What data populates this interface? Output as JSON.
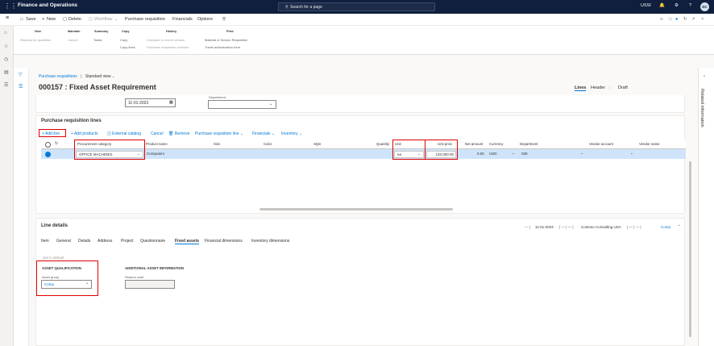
{
  "topbar": {
    "app_title": "Finance and Operations",
    "search_placeholder": "Search for a page",
    "company": "USSI",
    "avatar_initials": "DC"
  },
  "actions": {
    "save": "Save",
    "new": "New",
    "delete": "Delete",
    "workflow": "Workflow",
    "tab_purchase_requisition": "Purchase requisition",
    "tab_financials": "Financials",
    "tab_options": "Options"
  },
  "ribbon": {
    "groups": {
      "new": "New",
      "maintain": "Maintain",
      "summary": "Summary",
      "copy": "Copy",
      "history": "History",
      "print": "Print"
    },
    "items": {
      "request_for_quotation": "Request for quotation",
      "cancel": "Cancel",
      "totals": "Totals",
      "copy": "Copy",
      "copy_lines": "Copy lines",
      "compare_to_recent": "Compare to recent version",
      "purchase_requisition_versions": "Purchase requisition versions",
      "material_service_requisition": "Material & Service Requisition",
      "travel_authorization_form": "Travel authorization form"
    }
  },
  "breadcrumb": {
    "link": "Purchase requisitions",
    "separator": "|",
    "view": "Standard view"
  },
  "page": {
    "title": "000157 : Fixed Asset Requirement",
    "tab_lines": "Lines",
    "tab_header": "Header",
    "status": "Draft"
  },
  "header_fields": {
    "date_value": "11-01-2023",
    "department_label": "Department"
  },
  "lines": {
    "section_title": "Purchase requisition lines",
    "toolbar": {
      "add_line": "+ Add line",
      "add_products": "Add products",
      "external_catalog": "External catalog",
      "cancel": "Cancel",
      "remove": "Remove",
      "pr_line": "Purchase requisition line",
      "financials": "Financials",
      "inventory": "Inventory"
    },
    "columns": {
      "procurement_category": "Procurement category",
      "product_name": "Product name",
      "size": "Size",
      "color": "Color",
      "style": "Style",
      "quantity": "Quantity",
      "unit": "Unit",
      "unit_price": "Unit price",
      "net_amount": "Net amount",
      "currency": "Currency",
      "department": "Department",
      "vendor_account": "Vendor account",
      "vendor_name": "Vendor name"
    },
    "row": {
      "procurement_category": "OFFICE MACHINES",
      "product_name": "Computers",
      "unit": "ea",
      "unit_price": "120,000.00",
      "net_amount": "0.00",
      "currency": "USD",
      "department": "028"
    }
  },
  "line_details": {
    "title": "Line details",
    "summary": {
      "date": "11-01-2023",
      "vendor": "Contoso Consulting USA",
      "asset_group": "Comp"
    },
    "tabs": {
      "item": "Item",
      "general": "General",
      "details": "Details",
      "address": "Address",
      "project": "Project",
      "questionnaire": "Questionnaire",
      "fixed_assets": "Fixed assets",
      "financial_dimensions": "Financial dimensions",
      "inventory_dimensions": "Inventory dimensions"
    },
    "set_to_default": "Set to default",
    "asset_qualification": "ASSET QUALIFICATION",
    "asset_group_label": "Asset group",
    "asset_group_value": "Comp",
    "additional_info": "ADDITIONAL ASSET INFORMATION",
    "reason_code_label": "Reason code"
  },
  "side": {
    "related_information": "Related information"
  }
}
